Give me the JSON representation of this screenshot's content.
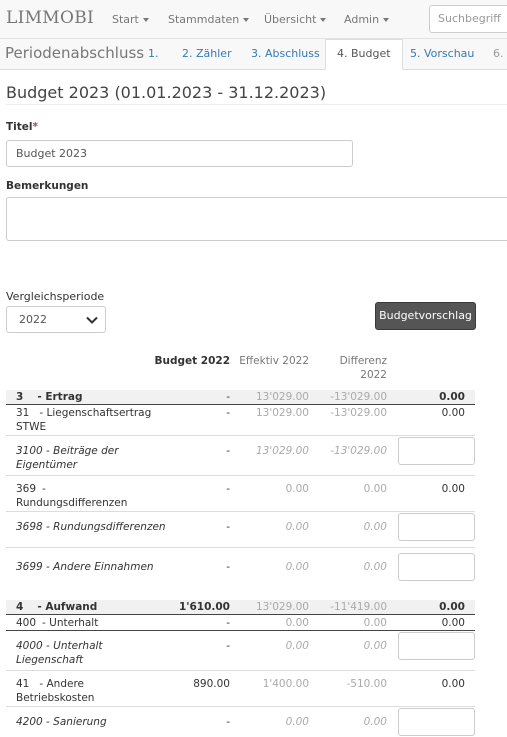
{
  "nav": {
    "brand": "LIMMOBI",
    "items": [
      "Start",
      "Stammdaten",
      "Übersicht",
      "Admin"
    ],
    "search_placeholder": "Suchbegriff"
  },
  "wizard": {
    "title": "Periodenabschluss",
    "steps": [
      "1.",
      "2. Zähler",
      "3. Abschluss",
      "4. Budget",
      "5. Vorschau",
      "6."
    ],
    "active_step": "4. Budget"
  },
  "page": {
    "title": "Budget 2023 (01.01.2023 - 31.12.2023)"
  },
  "form": {
    "titel_label": "Titel",
    "required_mark": "*",
    "titel_value": "Budget 2023",
    "bemerkungen_label": "Bemerkungen",
    "vergleich_label": "Vergleichsperiode",
    "vergleich_value": "2022",
    "budgetvorschlag_button": "Budgetvorschlag"
  },
  "table": {
    "headers": {
      "budget": "Budget 2022",
      "effektiv": "Effektiv 2022",
      "differenz_line1": "Differenz",
      "differenz_line2": "2022"
    },
    "rows": [
      {
        "num": "3",
        "name1": "- Ertrag",
        "budget": "-",
        "effektiv": "13'029.00",
        "differenz": "-13'029.00",
        "last": "0.00"
      },
      {
        "num": "31",
        "name1": "- Liegenschaftsertrag",
        "name2": "STWE",
        "budget": "-",
        "effektiv": "13'029.00",
        "differenz": "-13'029.00",
        "last": "0.00"
      },
      {
        "name1": "3100 - Beiträge der",
        "name2": "Eigentümer",
        "budget": "-",
        "effektiv": "13'029.00",
        "differenz": "-13'029.00"
      },
      {
        "num": "369",
        "name1": "-",
        "name2": "Rundungsdifferenzen",
        "budget": "-",
        "effektiv": "0.00",
        "differenz": "0.00",
        "last": "0.00"
      },
      {
        "name1": "3698 - Rundungsdifferenzen",
        "budget": "-",
        "effektiv": "0.00",
        "differenz": "0.00"
      },
      {
        "name1": "3699 - Andere Einnahmen",
        "budget": "-",
        "effektiv": "0.00",
        "differenz": "0.00"
      },
      {
        "num": "4",
        "name1": "- Aufwand",
        "budget": "1'610.00",
        "effektiv": "13'029.00",
        "differenz": "-11'419.00",
        "last": "0.00"
      },
      {
        "num": "400",
        "name1": "- Unterhalt",
        "budget": "-",
        "effektiv": "0.00",
        "differenz": "0.00",
        "last": "0.00"
      },
      {
        "name1": "4000 - Unterhalt",
        "name2": "Liegenschaft",
        "budget": "-",
        "effektiv": "0.00",
        "differenz": "0.00"
      },
      {
        "num": "41",
        "name1": "- Andere",
        "name2": "Betriebskosten",
        "budget": "890.00",
        "effektiv": "1'400.00",
        "differenz": "-510.00",
        "last": "0.00"
      },
      {
        "name1": "4200 - Sanierung",
        "budget": "-",
        "effektiv": "0.00",
        "differenz": "0.00"
      }
    ]
  }
}
